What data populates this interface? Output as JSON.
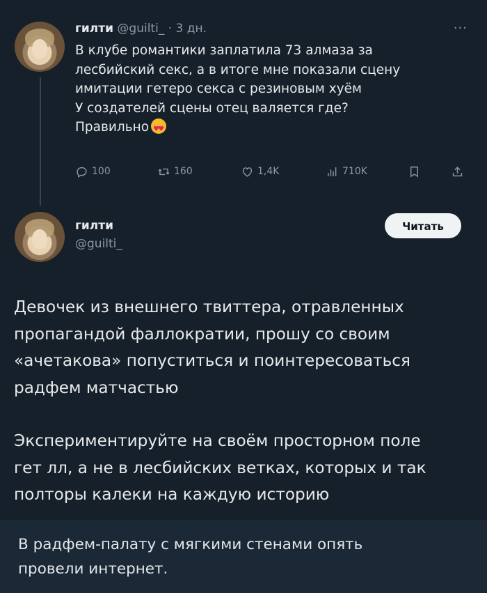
{
  "tweet1": {
    "name": "гилти",
    "handle": "@guilti_",
    "separator": "·",
    "time": "3 дн.",
    "more": "···",
    "lines": [
      "В клубе романтики заплатила 73 алмаза за",
      "лесбийский секс, а в итоге мне показали сцену",
      "имитации гетеро секса с резиновым хуём",
      "У создателей сцены отец валяется где?",
      "Правильно"
    ],
    "emoji": "smiling-face-with-heart-eyes",
    "stats": {
      "replies": "100",
      "reposts": "160",
      "likes": "1,4K",
      "views": "710K"
    }
  },
  "tweet2": {
    "name": "гилти",
    "handle": "@guilti_",
    "follow_label": "Читать",
    "paragraph1": [
      "Девочек из внешнего твиттера, отравленных",
      "пропагандой фаллократии, прошу со своим",
      "«ачетакова» попуститься и поинтересоваться",
      "радфем матчастью"
    ],
    "paragraph2": [
      "Экспериментируйте на своём просторном поле",
      "гет лл, а не в лесбийских ветках, которых и так",
      "полторы калеки на каждую историю"
    ]
  },
  "caption": {
    "lines": [
      "В радфем-палату с мягкими стенами опять",
      "провели интернет."
    ]
  },
  "colors": {
    "background": "#15202b",
    "caption_background": "#1b2937",
    "text": "#e7e9ea",
    "muted": "#8b98a5",
    "button_bg": "#eff3f4"
  }
}
